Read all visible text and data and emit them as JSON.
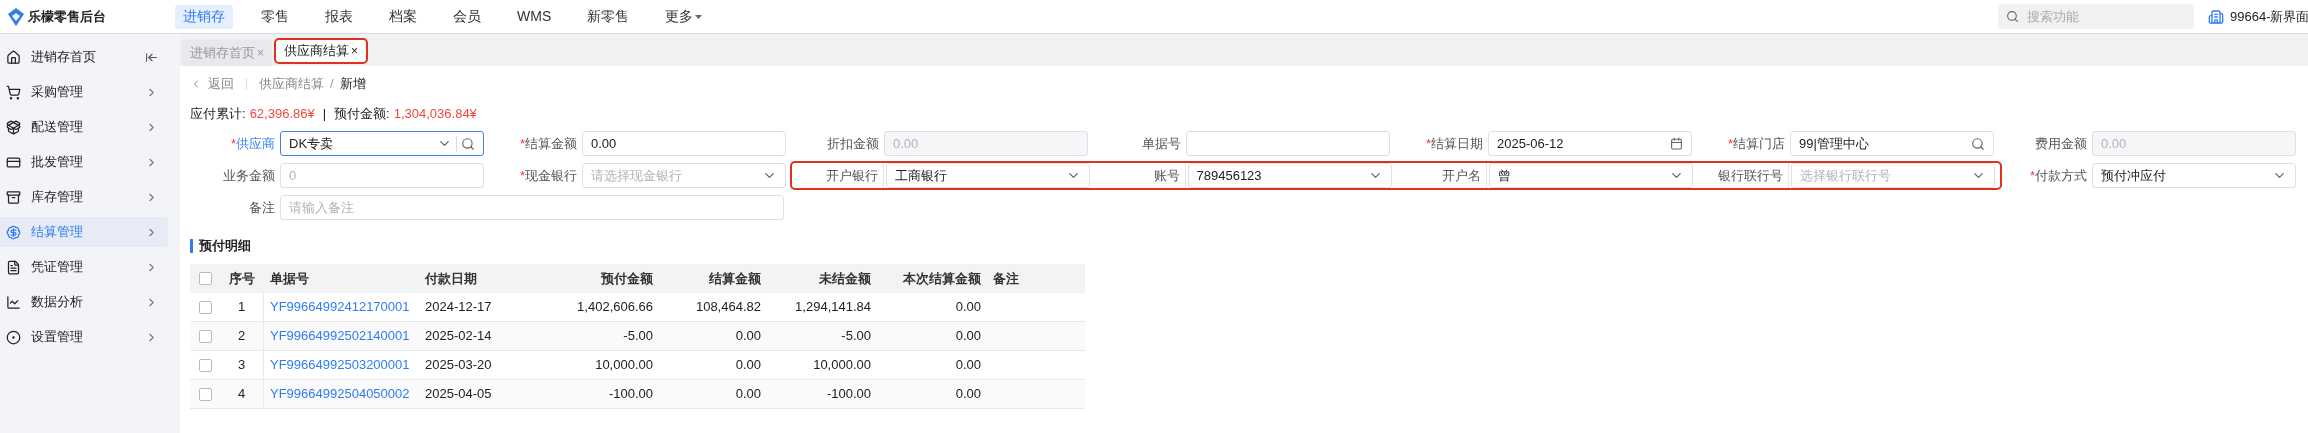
{
  "app": {
    "title": "乐檬零售后台"
  },
  "top_nav": [
    {
      "label": "进销存",
      "selected": true,
      "dropdown": false
    },
    {
      "label": "零售",
      "selected": false,
      "dropdown": false
    },
    {
      "label": "报表",
      "selected": false,
      "dropdown": false
    },
    {
      "label": "档案",
      "selected": false,
      "dropdown": false
    },
    {
      "label": "会员",
      "selected": false,
      "dropdown": false
    },
    {
      "label": "WMS",
      "selected": false,
      "dropdown": false
    },
    {
      "label": "新零售",
      "selected": false,
      "dropdown": false
    },
    {
      "label": "更多",
      "selected": false,
      "dropdown": true
    }
  ],
  "search": {
    "placeholder": "搜索功能"
  },
  "store": {
    "label": "99664-新界面"
  },
  "sidebar": {
    "items": [
      {
        "label": "进销存首页",
        "selected": false
      },
      {
        "label": "采购管理",
        "selected": false
      },
      {
        "label": "配送管理",
        "selected": false
      },
      {
        "label": "批发管理",
        "selected": false
      },
      {
        "label": "库存管理",
        "selected": false
      },
      {
        "label": "结算管理",
        "selected": true
      },
      {
        "label": "凭证管理",
        "selected": false
      },
      {
        "label": "数据分析",
        "selected": false
      },
      {
        "label": "设置管理",
        "selected": false
      }
    ]
  },
  "tabs": [
    {
      "label": "进销存首页",
      "selected": false,
      "highlighted": false,
      "close": "×"
    },
    {
      "label": "供应商结算",
      "selected": true,
      "highlighted": true,
      "close": "×"
    }
  ],
  "breadcrumb": {
    "back": "返回",
    "separator": "/",
    "path": [
      "供应商结算",
      "新增"
    ]
  },
  "summary": [
    {
      "label": "应付累计:",
      "value": "62,396.86¥"
    },
    {
      "label": "预付金额:",
      "value": "1,304,036.84¥"
    }
  ],
  "summary_separator": "|",
  "form": {
    "required_mark": "*",
    "rows": [
      [
        {
          "label": "供应商",
          "required": true,
          "focused": true,
          "grouped": false,
          "kind": "search-select",
          "value": "DK专卖"
        },
        {
          "label": "结算金额",
          "required": true,
          "focused": false,
          "grouped": false,
          "kind": "text",
          "value": "0.00"
        },
        {
          "label": "折扣金额",
          "required": false,
          "focused": false,
          "grouped": false,
          "kind": "disabled",
          "placeholder": "0.00"
        },
        {
          "label": "单据号",
          "required": false,
          "focused": false,
          "grouped": false,
          "kind": "text"
        },
        {
          "label": "结算日期",
          "required": true,
          "focused": false,
          "grouped": false,
          "kind": "date",
          "value": "2025-06-12"
        },
        {
          "label": "结算门店",
          "required": true,
          "focused": false,
          "grouped": false,
          "kind": "search",
          "value": "99|管理中心"
        },
        {
          "label": "费用金额",
          "required": false,
          "focused": false,
          "grouped": false,
          "kind": "disabled",
          "placeholder": "0.00"
        }
      ],
      [
        {
          "label": "业务金额",
          "required": false,
          "focused": false,
          "grouped": false,
          "kind": "text",
          "placeholder": "0"
        },
        {
          "label": "现金银行",
          "required": true,
          "focused": false,
          "grouped": false,
          "kind": "select",
          "placeholder": "请选择现金银行"
        },
        {
          "label": "开户银行",
          "required": false,
          "focused": false,
          "grouped": true,
          "kind": "select",
          "value": "工商银行"
        },
        {
          "label": "账号",
          "required": false,
          "focused": false,
          "grouped": true,
          "kind": "select",
          "value": "789456123"
        },
        {
          "label": "开户名",
          "required": false,
          "focused": false,
          "grouped": true,
          "kind": "select",
          "value": "曾"
        },
        {
          "label": "银行联行号",
          "required": false,
          "focused": false,
          "grouped": true,
          "kind": "select",
          "placeholder": "选择银行联行号"
        },
        {
          "label": "付款方式",
          "required": true,
          "focused": false,
          "grouped": false,
          "kind": "select",
          "value": "预付冲应付"
        }
      ],
      [
        {
          "label": "备注",
          "required": false,
          "focused": false,
          "grouped": false,
          "kind": "wide",
          "placeholder": "请输入备注"
        }
      ]
    ]
  },
  "section_title": "预付明细",
  "table": {
    "header_checked": false,
    "columns": [
      "序号",
      "单据号",
      "付款日期",
      "预付金额",
      "结算金额",
      "未结金额",
      "本次结算金额",
      "备注"
    ],
    "rows": [
      {
        "checked": false,
        "cells": [
          "1",
          "YF99664992412170001",
          "2024-12-17",
          "1,402,606.66",
          "108,464.82",
          "1,294,141.84",
          "0.00"
        ]
      },
      {
        "checked": false,
        "cells": [
          "2",
          "YF99664992502140001",
          "2025-02-14",
          "-5.00",
          "0.00",
          "-5.00",
          "0.00"
        ]
      },
      {
        "checked": false,
        "cells": [
          "3",
          "YF99664992503200001",
          "2025-03-20",
          "10,000.00",
          "0.00",
          "10,000.00",
          "0.00"
        ]
      },
      {
        "checked": false,
        "cells": [
          "4",
          "YF99664992504050002",
          "2025-04-05",
          "-100.00",
          "0.00",
          "-100.00",
          "0.00"
        ]
      }
    ]
  }
}
